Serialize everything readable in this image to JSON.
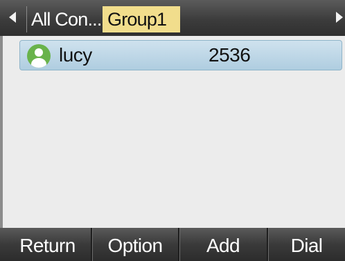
{
  "tabs": {
    "all_contacts_label": "All Con...",
    "group_label": "Group1"
  },
  "contacts": [
    {
      "name": "lucy",
      "number": "2536"
    }
  ],
  "softkeys": {
    "return_label": "Return",
    "option_label": "Option",
    "add_label": "Add",
    "dial_label": "Dial"
  },
  "colors": {
    "selected_tab": "#f1dd8c",
    "selected_row": "#bcd6e7",
    "avatar": "#69b34b"
  }
}
